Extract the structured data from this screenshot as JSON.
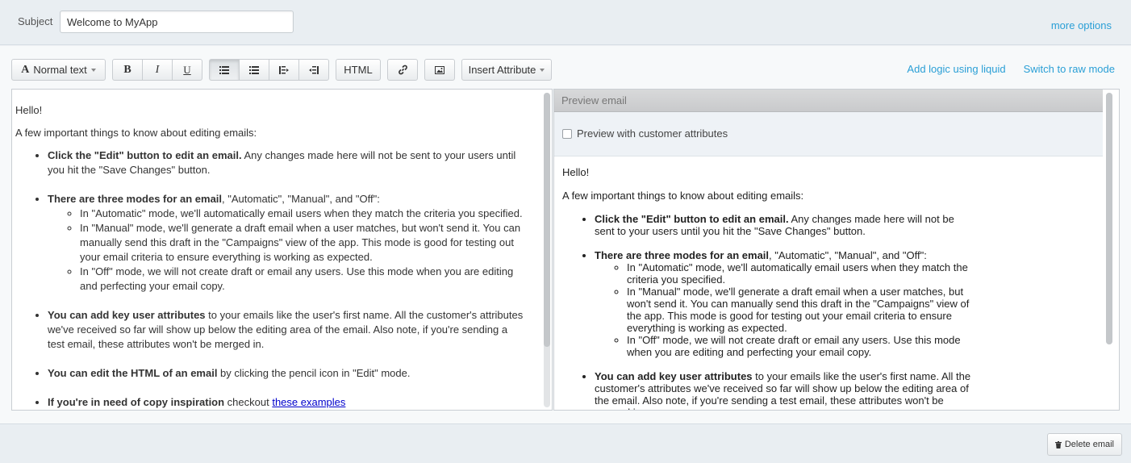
{
  "subject": {
    "label": "Subject",
    "value": "Welcome to MyApp"
  },
  "header": {
    "more_options": "more options"
  },
  "toolbar": {
    "text_style": "Normal text",
    "bold": "B",
    "italic": "I",
    "underline": "U",
    "html": "HTML",
    "insert_attribute": "Insert Attribute",
    "add_logic": "Add logic using liquid",
    "raw_mode": "Switch to raw mode"
  },
  "editor": {
    "greeting": "Hello!",
    "intro": "A few important things to know about editing emails:",
    "item1_bold": "Click the \"Edit\" button to edit an email.",
    "item1_text": " Any changes made here will not be sent to your users until you hit the \"Save Changes\" button.",
    "item2_bold": "There are three modes for an email",
    "item2_text": ", \"Automatic\", \"Manual\", and \"Off\":",
    "sub1": "In \"Automatic\" mode, we'll automatically email users when they match the criteria you specified.",
    "sub2": "In \"Manual\" mode, we'll generate a draft email when a user matches, but won't send it. You can manually send this draft in the \"Campaigns\" view of the app. This mode is good for testing out your email criteria to ensure everything is working as expected.",
    "sub3": "In \"Off\" mode, we will not create draft or email any users. Use this mode when you are editing and perfecting your email copy.",
    "item3_bold": "You can add key user attributes",
    "item3_text": " to your emails like the user's first name. All the customer's attributes we've received so far will show up below the editing area of the email. Also note, if you're sending a test email, these attributes won't be merged in.",
    "item4_bold": "You can edit the HTML of an email",
    "item4_text": " by clicking the pencil icon in \"Edit\" mode.",
    "item5_bold": "If you're in need of copy inspiration",
    "item5_text": " checkout ",
    "item5_link": "these examples"
  },
  "preview": {
    "title": "Preview email",
    "checkbox_label": "Preview with customer attributes",
    "checkbox_checked": false
  },
  "footer": {
    "delete_label": "Delete email"
  },
  "colors": {
    "link": "#2a9fd6",
    "panel_bg": "#f7f9fa",
    "bar_bg": "#e9eef2"
  },
  "icons": [
    "text-style-icon",
    "bullet-list-icon",
    "numbered-list-icon",
    "outdent-icon",
    "indent-icon",
    "link-icon",
    "image-icon",
    "trash-icon"
  ]
}
